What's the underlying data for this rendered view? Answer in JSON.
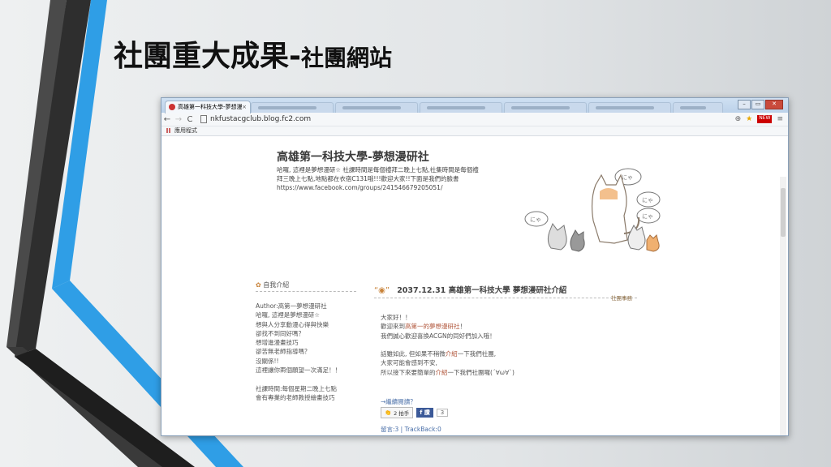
{
  "slide": {
    "title": "社團重大成果-",
    "subtitle": "社團網站"
  },
  "browser": {
    "tab_title": "高雄第一科技大學-夢想漫",
    "tab_close": "×",
    "url": "nkfustacgclub.blog.fc2.com",
    "bookmark": "應用程式",
    "new_badge": "NEW"
  },
  "blog": {
    "title": "高雄第一科技大學-夢想漫研社",
    "description": [
      "哈囉, 這裡是夢想漫研☆ 社課時間是每個禮拜二晚上七點,社集時間是每個禮",
      "拜三晚上七點,地點都在衣宿C131哦!!!歡迎大家!!下面是我們的臉書",
      "https://www.facebook.com/groups/241546679205051/"
    ],
    "sidebar": {
      "heading": "自我介紹",
      "lines_a": [
        "Author:高第一夢想漫研社",
        "哈囉, 這裡是夢想漫研☆",
        "想與人分享動漫心得與快樂",
        "卻找不到同好嗎？",
        "想增進漫畫技巧",
        "卻苦無老師指導嗎？",
        "沒關係!!",
        "這裡讓你兩個願望一次滿足！！"
      ],
      "lines_b": [
        "社課時間:每個星期二晚上七點",
        "會有專業的老師教授繪畫技巧"
      ]
    },
    "post": {
      "title": "2037.12.31 高雄第一科技大學 夢想漫研社介紹",
      "category": "社團事務",
      "para1": [
        "大家好！！",
        "歡迎來到高第一的夢想漫研社！",
        "我們誠心歡迎喜換ACGN的同好們加入哦！"
      ],
      "para2": [
        "話雖如此, 但如果不稍微介紹一下我們社團,",
        "大家可能會感到不安,",
        "所以接下來要簡單的介紹一下我們社團囉(´∀ω∀`)"
      ],
      "more": "→繼續閱讀？",
      "like_count": "2 拍手",
      "share_label": "f 讚",
      "share_count": "3",
      "footer": "留言:3 | TrackBack:0"
    }
  },
  "colors": {
    "accent_blue": "#2f9ee6",
    "dark_band": "#3a3a3a",
    "post_highlight": "#b0553a"
  }
}
